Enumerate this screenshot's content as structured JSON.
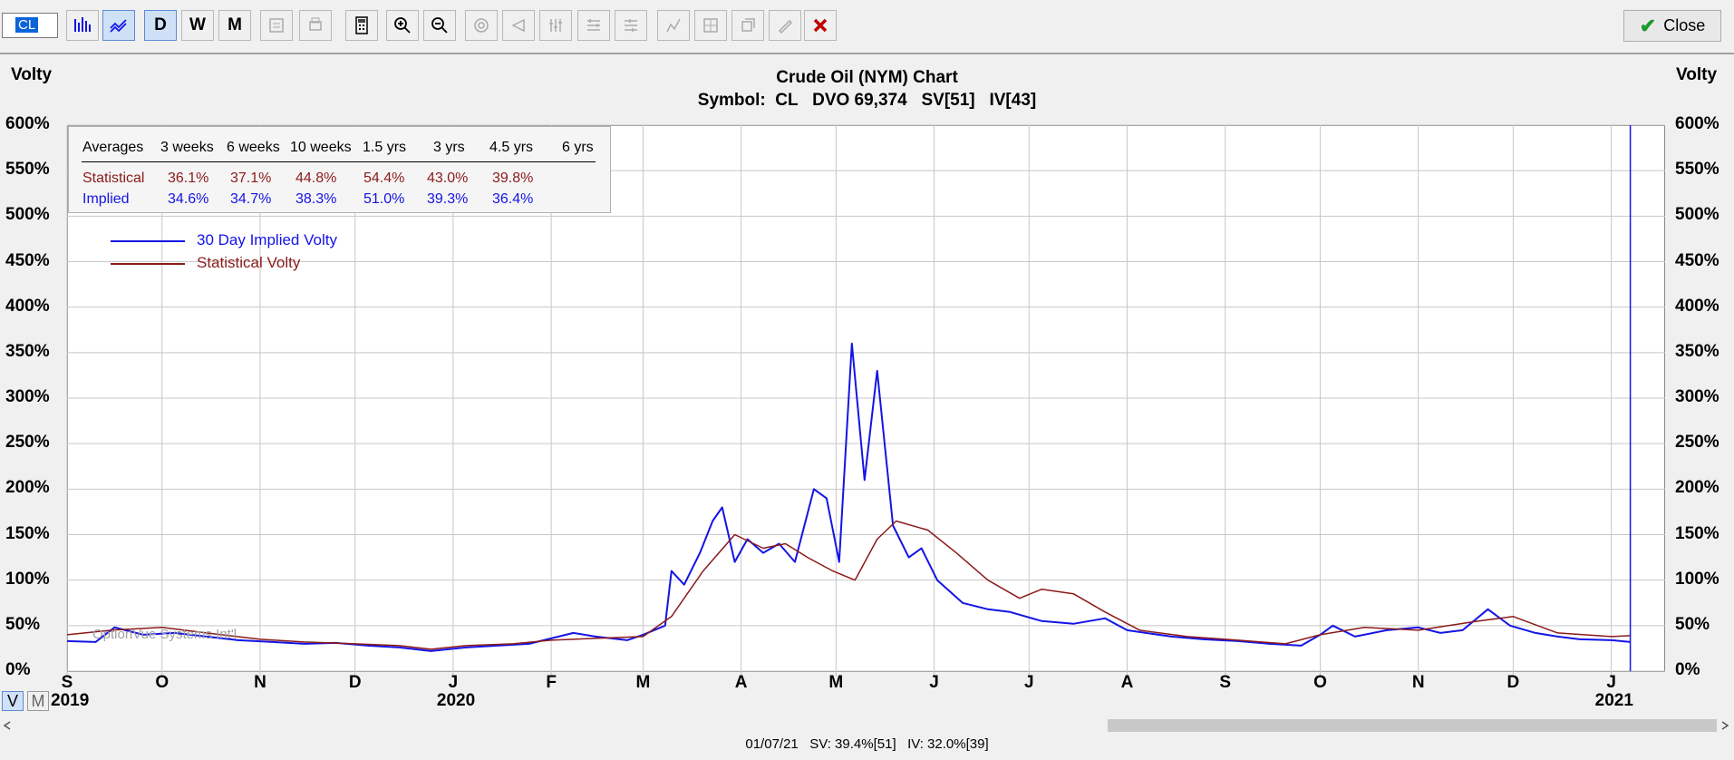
{
  "toolbar": {
    "symbol_value": "CL",
    "period_buttons": [
      "D",
      "W",
      "M"
    ],
    "close_label": "Close"
  },
  "chart_header": {
    "title": "Crude Oil (NYM) Chart",
    "subtitle": "Symbol:  CL   DVO 69,374   SV[51]   IV[43]"
  },
  "axis": {
    "left_label": "Volty",
    "right_label": "Volty"
  },
  "averages": {
    "headers": [
      "Averages",
      "3 weeks",
      "6 weeks",
      "10 weeks",
      "1.5 yrs",
      "3 yrs",
      "4.5 yrs",
      "6 yrs"
    ],
    "rows": [
      {
        "label": "Statistical",
        "values": [
          "36.1%",
          "37.1%",
          "44.8%",
          "54.4%",
          "43.0%",
          "39.8%",
          ""
        ]
      },
      {
        "label": "Implied",
        "values": [
          "34.6%",
          "34.7%",
          "38.3%",
          "51.0%",
          "39.3%",
          "36.4%",
          ""
        ]
      }
    ]
  },
  "watermark": "OptionVue Systems Int'l",
  "view_toggle": {
    "v": "V",
    "m": "M"
  },
  "status_bar": "01/07/21   SV: 39.4%[51]   IV: 32.0%[39]",
  "colors": {
    "implied": "#1414e6",
    "statistical": "#8b1a1a",
    "grid": "#c8c8c8",
    "close_x": "#c00000"
  },
  "chart_data": {
    "type": "line",
    "ylim": [
      0,
      600
    ],
    "yticks": [
      "0%",
      "50%",
      "100%",
      "150%",
      "200%",
      "250%",
      "300%",
      "350%",
      "400%",
      "450%",
      "500%",
      "550%",
      "600%"
    ],
    "xlim": [
      "2019-09-01",
      "2021-01-18"
    ],
    "month_labels": [
      {
        "label": "S",
        "date": "2019-09-01"
      },
      {
        "label": "O",
        "date": "2019-10-01"
      },
      {
        "label": "N",
        "date": "2019-11-01"
      },
      {
        "label": "D",
        "date": "2019-12-01"
      },
      {
        "label": "J",
        "date": "2020-01-01"
      },
      {
        "label": "F",
        "date": "2020-02-01"
      },
      {
        "label": "M",
        "date": "2020-03-01"
      },
      {
        "label": "A",
        "date": "2020-04-01"
      },
      {
        "label": "M",
        "date": "2020-05-01"
      },
      {
        "label": "J",
        "date": "2020-06-01"
      },
      {
        "label": "J",
        "date": "2020-07-01"
      },
      {
        "label": "A",
        "date": "2020-08-01"
      },
      {
        "label": "S",
        "date": "2020-09-01"
      },
      {
        "label": "O",
        "date": "2020-10-01"
      },
      {
        "label": "N",
        "date": "2020-11-01"
      },
      {
        "label": "D",
        "date": "2020-12-01"
      },
      {
        "label": "J",
        "date": "2021-01-01"
      }
    ],
    "year_labels": [
      {
        "label": "2019",
        "date": "2019-09-01"
      },
      {
        "label": "2020",
        "date": "2020-01-01"
      },
      {
        "label": "2021",
        "date": "2021-01-01"
      }
    ],
    "cursor_date": "2021-01-07",
    "series": [
      {
        "name": "30 Day Implied Volty",
        "color": "#1414e6",
        "points": [
          [
            "2019-09-01",
            33
          ],
          [
            "2019-09-10",
            32
          ],
          [
            "2019-09-16",
            48
          ],
          [
            "2019-09-25",
            40
          ],
          [
            "2019-10-05",
            42
          ],
          [
            "2019-10-15",
            38
          ],
          [
            "2019-10-25",
            34
          ],
          [
            "2019-11-05",
            32
          ],
          [
            "2019-11-15",
            30
          ],
          [
            "2019-11-25",
            31
          ],
          [
            "2019-12-05",
            28
          ],
          [
            "2019-12-15",
            26
          ],
          [
            "2019-12-25",
            22
          ],
          [
            "2020-01-05",
            26
          ],
          [
            "2020-01-15",
            28
          ],
          [
            "2020-01-25",
            30
          ],
          [
            "2020-02-01",
            36
          ],
          [
            "2020-02-08",
            42
          ],
          [
            "2020-02-15",
            38
          ],
          [
            "2020-02-25",
            34
          ],
          [
            "2020-03-01",
            40
          ],
          [
            "2020-03-08",
            50
          ],
          [
            "2020-03-10",
            110
          ],
          [
            "2020-03-14",
            95
          ],
          [
            "2020-03-19",
            130
          ],
          [
            "2020-03-23",
            165
          ],
          [
            "2020-03-26",
            180
          ],
          [
            "2020-03-30",
            120
          ],
          [
            "2020-04-03",
            145
          ],
          [
            "2020-04-08",
            130
          ],
          [
            "2020-04-13",
            140
          ],
          [
            "2020-04-18",
            120
          ],
          [
            "2020-04-24",
            200
          ],
          [
            "2020-04-28",
            190
          ],
          [
            "2020-05-02",
            120
          ],
          [
            "2020-05-06",
            360
          ],
          [
            "2020-05-10",
            210
          ],
          [
            "2020-05-14",
            330
          ],
          [
            "2020-05-19",
            160
          ],
          [
            "2020-05-24",
            125
          ],
          [
            "2020-05-28",
            135
          ],
          [
            "2020-06-02",
            100
          ],
          [
            "2020-06-10",
            75
          ],
          [
            "2020-06-18",
            68
          ],
          [
            "2020-06-25",
            65
          ],
          [
            "2020-07-05",
            55
          ],
          [
            "2020-07-15",
            52
          ],
          [
            "2020-07-25",
            58
          ],
          [
            "2020-08-01",
            45
          ],
          [
            "2020-08-15",
            38
          ],
          [
            "2020-08-25",
            35
          ],
          [
            "2020-09-05",
            33
          ],
          [
            "2020-09-15",
            30
          ],
          [
            "2020-09-25",
            28
          ],
          [
            "2020-10-01",
            40
          ],
          [
            "2020-10-05",
            50
          ],
          [
            "2020-10-12",
            38
          ],
          [
            "2020-10-22",
            45
          ],
          [
            "2020-11-01",
            48
          ],
          [
            "2020-11-08",
            42
          ],
          [
            "2020-11-15",
            45
          ],
          [
            "2020-11-23",
            68
          ],
          [
            "2020-11-30",
            50
          ],
          [
            "2020-12-08",
            42
          ],
          [
            "2020-12-15",
            38
          ],
          [
            "2020-12-22",
            35
          ],
          [
            "2021-01-01",
            34
          ],
          [
            "2021-01-07",
            32
          ]
        ]
      },
      {
        "name": "Statistical Volty",
        "color": "#8b1a1a",
        "points": [
          [
            "2019-09-01",
            40
          ],
          [
            "2019-09-15",
            45
          ],
          [
            "2019-10-01",
            48
          ],
          [
            "2019-10-15",
            42
          ],
          [
            "2019-11-01",
            35
          ],
          [
            "2019-11-15",
            32
          ],
          [
            "2019-12-01",
            30
          ],
          [
            "2019-12-15",
            28
          ],
          [
            "2019-12-25",
            24
          ],
          [
            "2020-01-05",
            28
          ],
          [
            "2020-01-20",
            30
          ],
          [
            "2020-02-01",
            34
          ],
          [
            "2020-02-15",
            36
          ],
          [
            "2020-03-01",
            38
          ],
          [
            "2020-03-10",
            60
          ],
          [
            "2020-03-20",
            110
          ],
          [
            "2020-03-30",
            150
          ],
          [
            "2020-04-08",
            135
          ],
          [
            "2020-04-15",
            140
          ],
          [
            "2020-04-22",
            125
          ],
          [
            "2020-04-30",
            110
          ],
          [
            "2020-05-07",
            100
          ],
          [
            "2020-05-14",
            145
          ],
          [
            "2020-05-20",
            165
          ],
          [
            "2020-05-30",
            155
          ],
          [
            "2020-06-08",
            130
          ],
          [
            "2020-06-18",
            100
          ],
          [
            "2020-06-28",
            80
          ],
          [
            "2020-07-05",
            90
          ],
          [
            "2020-07-15",
            85
          ],
          [
            "2020-07-25",
            65
          ],
          [
            "2020-08-05",
            45
          ],
          [
            "2020-08-20",
            38
          ],
          [
            "2020-09-05",
            34
          ],
          [
            "2020-09-20",
            30
          ],
          [
            "2020-10-01",
            40
          ],
          [
            "2020-10-15",
            48
          ],
          [
            "2020-11-01",
            45
          ],
          [
            "2020-11-20",
            55
          ],
          [
            "2020-12-01",
            60
          ],
          [
            "2020-12-15",
            42
          ],
          [
            "2021-01-01",
            38
          ],
          [
            "2021-01-07",
            39
          ]
        ]
      }
    ]
  }
}
